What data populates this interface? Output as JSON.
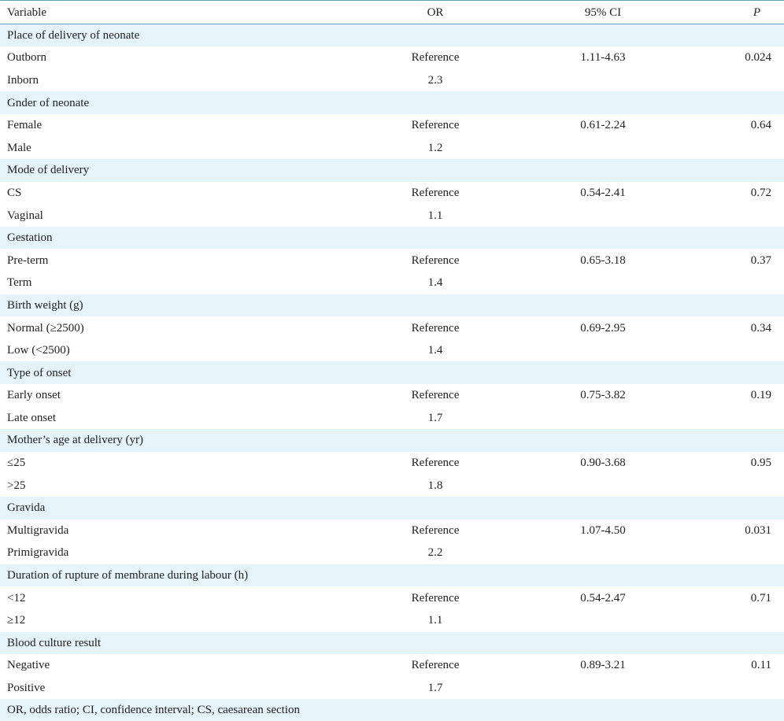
{
  "headers": {
    "variable": "Variable",
    "or": "OR",
    "ci": "95% CI",
    "p": "P"
  },
  "groups": [
    {
      "title": "Place of delivery of neonate",
      "rows": [
        {
          "label": "Outborn",
          "or": "Reference",
          "ci": "1.11-4.63",
          "p": "0.024"
        },
        {
          "label": "Inborn",
          "or": "2.3",
          "ci": "",
          "p": ""
        }
      ]
    },
    {
      "title": "Gnder of neonate",
      "rows": [
        {
          "label": "Female",
          "or": "Reference",
          "ci": "0.61-2.24",
          "p": "0.64"
        },
        {
          "label": "Male",
          "or": "1.2",
          "ci": "",
          "p": ""
        }
      ]
    },
    {
      "title": "Mode of delivery",
      "rows": [
        {
          "label": "CS",
          "or": "Reference",
          "ci": "0.54-2.41",
          "p": "0.72"
        },
        {
          "label": "Vaginal",
          "or": "1.1",
          "ci": "",
          "p": ""
        }
      ]
    },
    {
      "title": "Gestation",
      "rows": [
        {
          "label": "Pre-term",
          "or": "Reference",
          "ci": "0.65-3.18",
          "p": "0.37"
        },
        {
          "label": "Term",
          "or": "1.4",
          "ci": "",
          "p": ""
        }
      ]
    },
    {
      "title": "Birth weight (g)",
      "rows": [
        {
          "label": "Normal (≥2500)",
          "or": "Reference",
          "ci": "0.69-2.95",
          "p": "0.34"
        },
        {
          "label": "Low (<2500)",
          "or": "1.4",
          "ci": "",
          "p": ""
        }
      ]
    },
    {
      "title": "Type of onset",
      "rows": [
        {
          "label": "Early onset",
          "or": "Reference",
          "ci": "0.75-3.82",
          "p": "0.19"
        },
        {
          "label": "Late onset",
          "or": "1.7",
          "ci": "",
          "p": ""
        }
      ]
    },
    {
      "title": "Mother’s age at delivery (yr)",
      "rows": [
        {
          "label": "≤25",
          "or": "Reference",
          "ci": "0.90-3.68",
          "p": "0.95"
        },
        {
          "label": ">25",
          "or": "1.8",
          "ci": "",
          "p": ""
        }
      ]
    },
    {
      "title": "Gravida",
      "rows": [
        {
          "label": "Multigravida",
          "or": "Reference",
          "ci": "1.07-4.50",
          "p": "0.031"
        },
        {
          "label": "Primigravida",
          "or": "2.2",
          "ci": "",
          "p": ""
        }
      ]
    },
    {
      "title": "Duration of rupture of membrane during labour (h)",
      "rows": [
        {
          "label": "<12",
          "or": "Reference",
          "ci": "0.54-2.47",
          "p": "0.71"
        },
        {
          "label": "≥12",
          "or": "1.1",
          "ci": "",
          "p": ""
        }
      ]
    },
    {
      "title": "Blood culture result",
      "rows": [
        {
          "label": "Negative",
          "or": "Reference",
          "ci": "0.89-3.21",
          "p": "0.11"
        },
        {
          "label": "Positive",
          "or": "1.7",
          "ci": "",
          "p": ""
        }
      ]
    }
  ],
  "footnote": "OR, odds ratio; CI, confidence interval; CS, caesarean section"
}
